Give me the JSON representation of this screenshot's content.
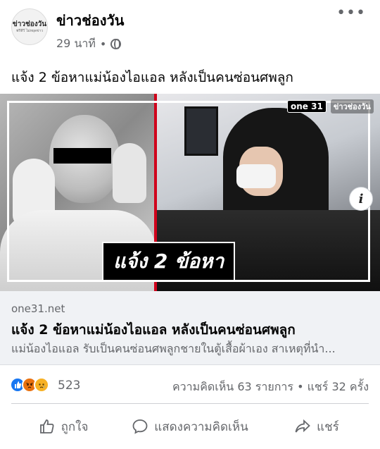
{
  "header": {
    "page_name": "ข่าวช่องวัน",
    "avatar_logo": "ข่าวช่องวัน",
    "avatar_sub": "ฟรีทีวี ไม่หยุดข่าว",
    "time": "29 นาที",
    "separator": "•",
    "more": "•••"
  },
  "post": {
    "text": "แจ้ง 2 ข้อหาแม่น้องไอแอล หลังเป็นคนซ่อนศพลูก"
  },
  "media": {
    "caption": "แจ้ง 2 ข้อหา",
    "channel_badge": "one 31",
    "news_logo": "ข่าวช่องวัน",
    "info": "i"
  },
  "link": {
    "domain": "one31.net",
    "title": "แจ้ง 2 ข้อหาแม่น้องไอแอล หลังเป็นคนซ่อนศพลูก",
    "description": "แม่น้องไอแอล รับเป็นคนซ่อนศพลูกชายในตู้เสื้อผ้าเอง สาเหตุที่นำ..."
  },
  "reactions": {
    "count": "523",
    "summary": "ความคิดเห็น 63 รายการ • แชร์ 32 ครั้ง",
    "icons": [
      "like-icon",
      "angry-icon",
      "sad-icon"
    ],
    "colors": {
      "like": "#1877f2",
      "angry": "#e9710f",
      "sad": "#f7b125"
    }
  },
  "actions": {
    "like": "ถูกใจ",
    "comment": "แสดงความคิดเห็น",
    "share": "แชร์"
  }
}
